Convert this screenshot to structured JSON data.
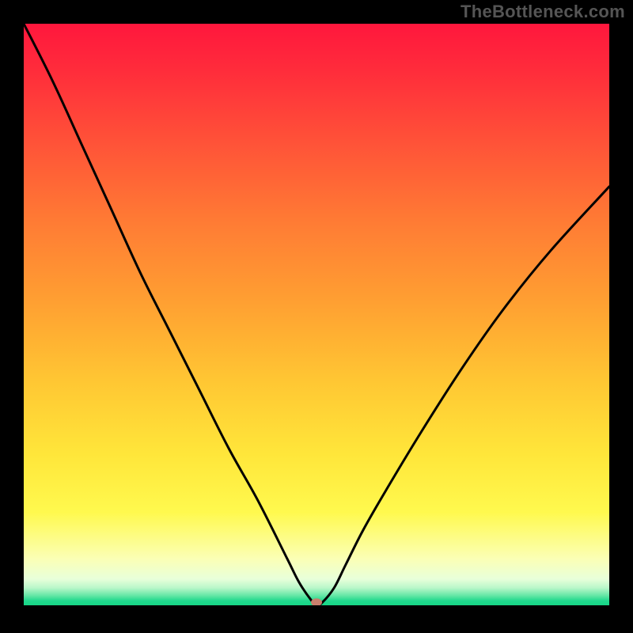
{
  "attribution": "TheBottleneck.com",
  "chart_data": {
    "type": "line",
    "title": "",
    "xlabel": "",
    "ylabel": "",
    "xlim": [
      0,
      100
    ],
    "ylim": [
      0,
      100
    ],
    "background_gradient": {
      "top_color": "#ff173d",
      "mid_color": "#ffe63a",
      "bottom_color": "#16d686"
    },
    "series": [
      {
        "name": "bottleneck-curve",
        "x": [
          0,
          5,
          10,
          15,
          20,
          25,
          30,
          35,
          40,
          45,
          47,
          49,
          50,
          51,
          53,
          55,
          58,
          62,
          68,
          75,
          82,
          90,
          100
        ],
        "y": [
          100,
          90,
          79,
          68,
          57,
          47,
          37,
          27,
          18,
          8,
          4,
          1,
          0,
          0.5,
          3,
          7,
          13,
          20,
          30,
          41,
          51,
          61,
          72
        ]
      }
    ],
    "marker": {
      "x": 50,
      "y": 0.5,
      "color": "#c97f6d"
    }
  }
}
